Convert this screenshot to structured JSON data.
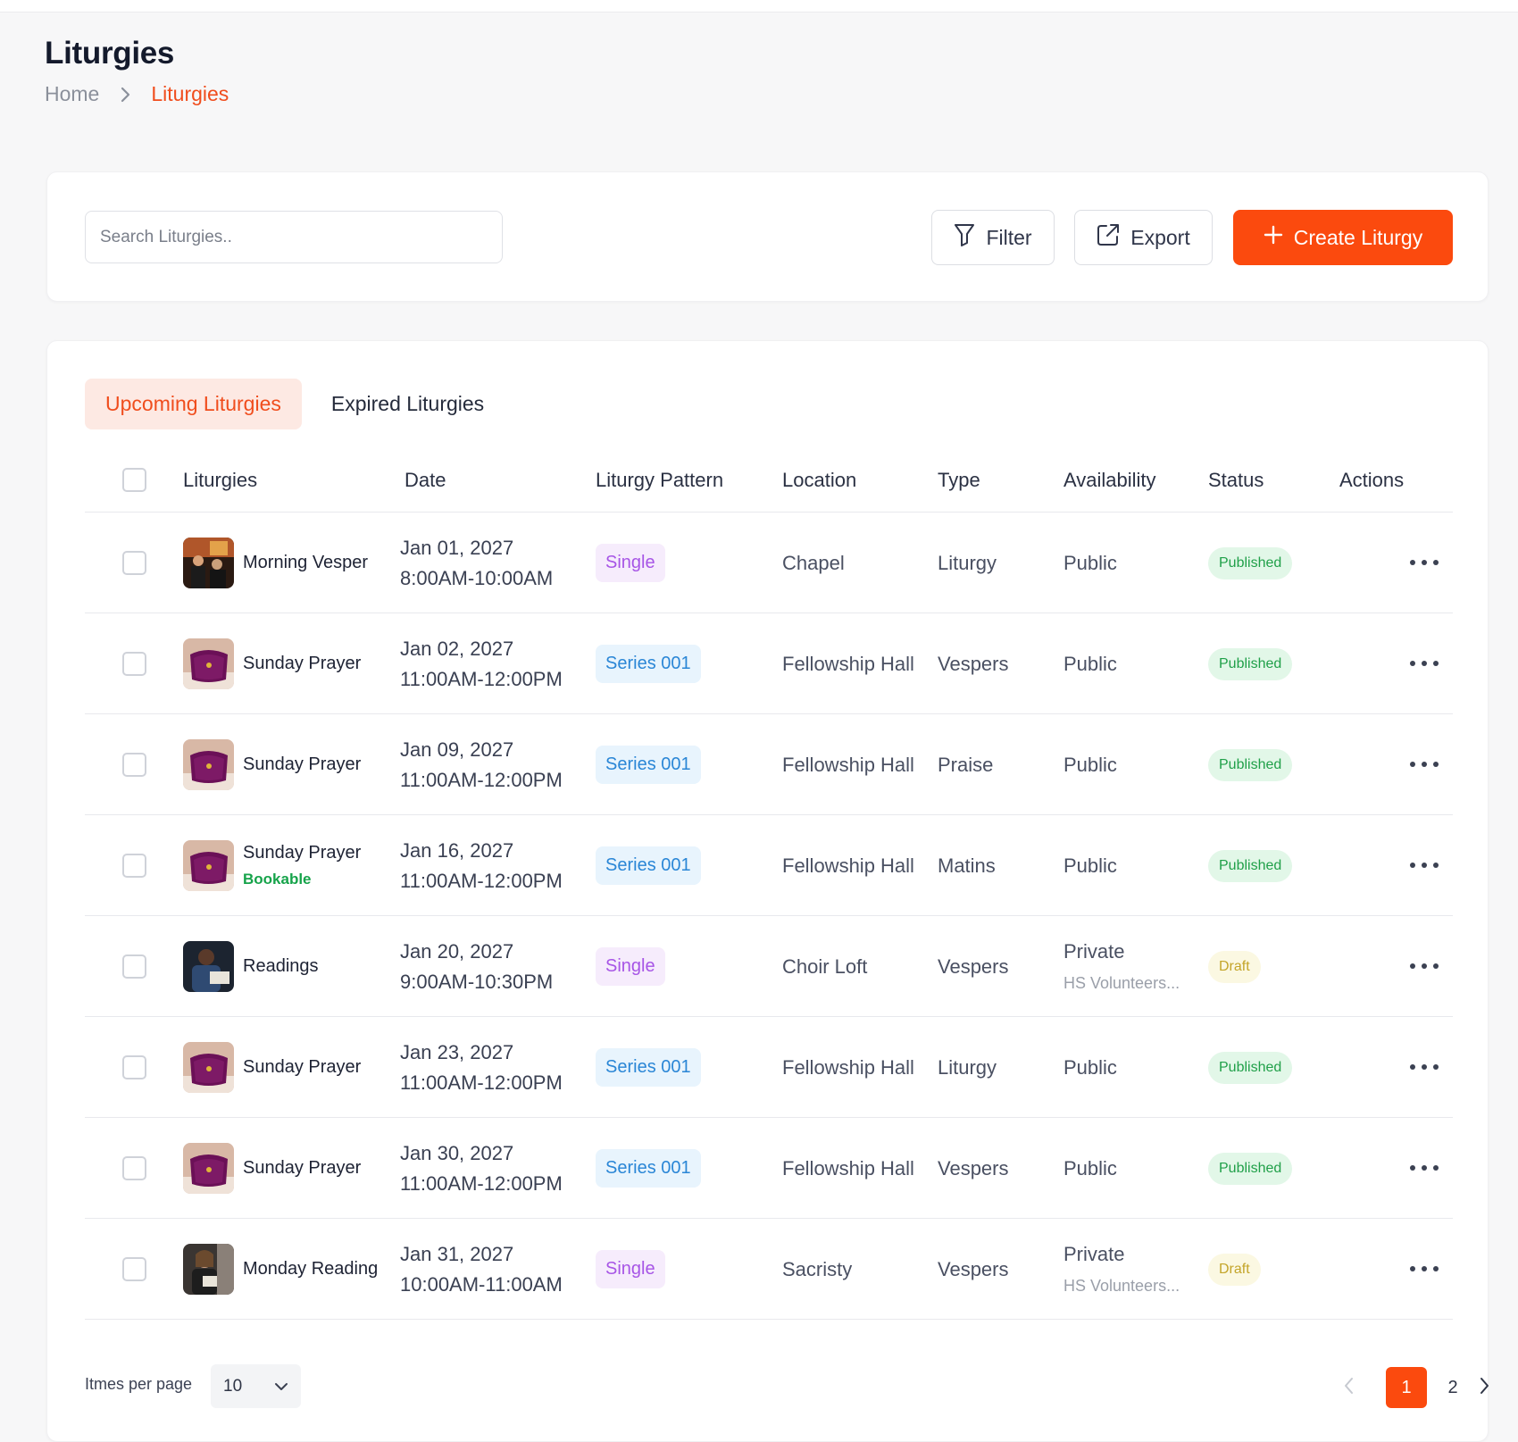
{
  "header": {
    "title": "Liturgies",
    "breadcrumb": {
      "home": "Home",
      "current": "Liturgies"
    }
  },
  "toolbar": {
    "search_placeholder": "Search Liturgies..",
    "filter_label": "Filter",
    "export_label": "Export",
    "create_label": "Create Liturgy"
  },
  "tabs": {
    "upcoming": "Upcoming Liturgies",
    "expired": "Expired Liturgies"
  },
  "table": {
    "columns": [
      "Liturgies",
      "Date",
      "Liturgy Pattern",
      "Location",
      "Type",
      "Availability",
      "Status",
      "Actions"
    ],
    "rows": [
      {
        "name": "Morning Vesper",
        "bookable": "",
        "date": "Jan 01, 2027",
        "time": "8:00AM-10:00AM",
        "pattern": "Single",
        "location": "Chapel",
        "type": "Liturgy",
        "availability": "Public",
        "availability_sub": "",
        "status": "Published"
      },
      {
        "name": "Sunday Prayer",
        "bookable": "",
        "date": "Jan 02, 2027",
        "time": "11:00AM-12:00PM",
        "pattern": "Series 001",
        "location": "Fellowship Hall",
        "type": "Vespers",
        "availability": "Public",
        "availability_sub": "",
        "status": "Published"
      },
      {
        "name": "Sunday Prayer",
        "bookable": "",
        "date": "Jan 09, 2027",
        "time": "11:00AM-12:00PM",
        "pattern": "Series 001",
        "location": "Fellowship Hall",
        "type": "Praise",
        "availability": "Public",
        "availability_sub": "",
        "status": "Published"
      },
      {
        "name": "Sunday Prayer",
        "bookable": "Bookable",
        "date": "Jan 16, 2027",
        "time": "11:00AM-12:00PM",
        "pattern": "Series 001",
        "location": "Fellowship Hall",
        "type": "Matins",
        "availability": "Public",
        "availability_sub": "",
        "status": "Published"
      },
      {
        "name": "Readings",
        "bookable": "",
        "date": "Jan 20, 2027",
        "time": "9:00AM-10:30PM",
        "pattern": "Single",
        "location": "Choir Loft",
        "type": "Vespers",
        "availability": "Private",
        "availability_sub": "HS Volunteers...",
        "status": "Draft"
      },
      {
        "name": "Sunday Prayer",
        "bookable": "",
        "date": "Jan 23, 2027",
        "time": "11:00AM-12:00PM",
        "pattern": "Series 001",
        "location": "Fellowship Hall",
        "type": "Liturgy",
        "availability": "Public",
        "availability_sub": "",
        "status": "Published"
      },
      {
        "name": "Sunday Prayer",
        "bookable": "",
        "date": "Jan 30, 2027",
        "time": "11:00AM-12:00PM",
        "pattern": "Series 001",
        "location": "Fellowship Hall",
        "type": "Vespers",
        "availability": "Public",
        "availability_sub": "",
        "status": "Published"
      },
      {
        "name": "Monday Reading",
        "bookable": "",
        "date": "Jan 31, 2027",
        "time": "10:00AM-11:00AM",
        "pattern": "Single",
        "location": "Sacristy",
        "type": "Vespers",
        "availability": "Private",
        "availability_sub": "HS Volunteers...",
        "status": "Draft"
      }
    ]
  },
  "footer": {
    "items_per_page_label": "Itmes per page",
    "items_per_page_value": "10",
    "pages": [
      "1",
      "2"
    ],
    "current_page": "1"
  },
  "colors": {
    "accent": "#fb4a0e",
    "published": "#20a049",
    "draft": "#c4a52a",
    "single": "#a755e6",
    "series": "#2a86d6"
  }
}
